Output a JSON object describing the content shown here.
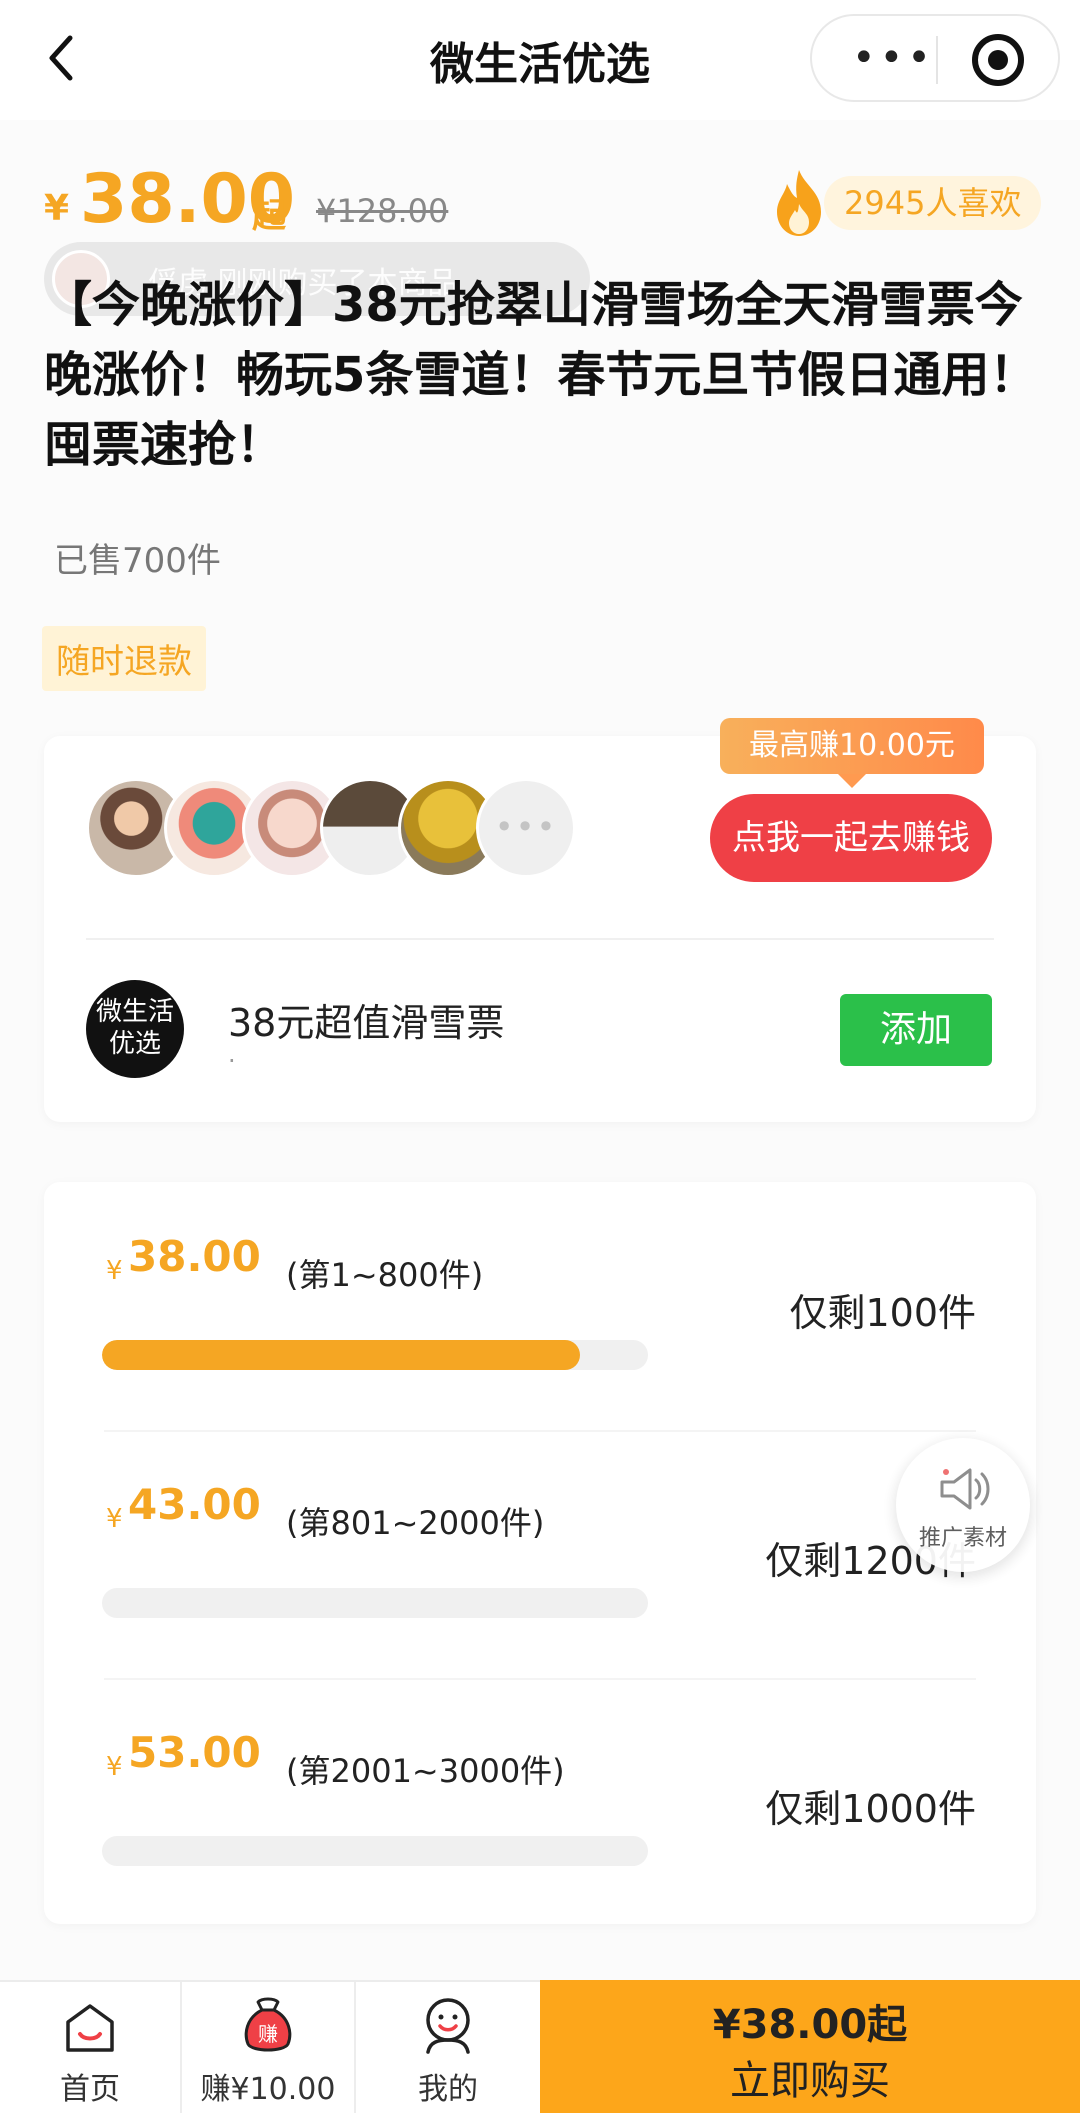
{
  "header": {
    "title": "微生活优选",
    "menu_icon": "more-dots-icon",
    "close_icon": "target-icon"
  },
  "price": {
    "yen": "¥",
    "amount": "38.00",
    "suffix": "起",
    "original": "¥128.00",
    "likes": "2945人喜欢"
  },
  "ticker": {
    "text": "俘虏 刚刚购买了本商品"
  },
  "product": {
    "title": "【今晚涨价】38元抢翠山滑雪场全天滑雪票今晚涨价！畅玩5条雪道！春节元旦节假日通用！囤票速抢！",
    "sold": "已售700件",
    "tag": "随时退款"
  },
  "earn": {
    "tip": "最高赚10.00元",
    "button": "点我一起去赚钱",
    "more_icon": "more-dots-icon"
  },
  "miniprogram": {
    "logo_line1": "微生活",
    "logo_line2": "优选",
    "name": "38元超值滑雪票",
    "sub": ".",
    "add_button": "添加"
  },
  "tiers": [
    {
      "yen": "¥",
      "price": "38.00",
      "range": "(第1~800件)",
      "remaining": "仅剩100件",
      "progress": 0.875
    },
    {
      "yen": "¥",
      "price": "43.00",
      "range": "(第801~2000件)",
      "remaining": "仅剩1200件",
      "progress": 0
    },
    {
      "yen": "¥",
      "price": "53.00",
      "range": "(第2001~3000件)",
      "remaining": "仅剩1000件",
      "progress": 0
    }
  ],
  "promo": {
    "label": "推广素材"
  },
  "tabbar": {
    "home": "首页",
    "earn": "赚¥10.00",
    "earn_badge": "赚",
    "mine": "我的",
    "buy_price": "¥38.00起",
    "buy_label": "立即购买"
  },
  "colors": {
    "accent": "#f5a623",
    "earn_red": "#ef4046",
    "add_green": "#2bc04a",
    "buy_bg": "#fda61a"
  }
}
